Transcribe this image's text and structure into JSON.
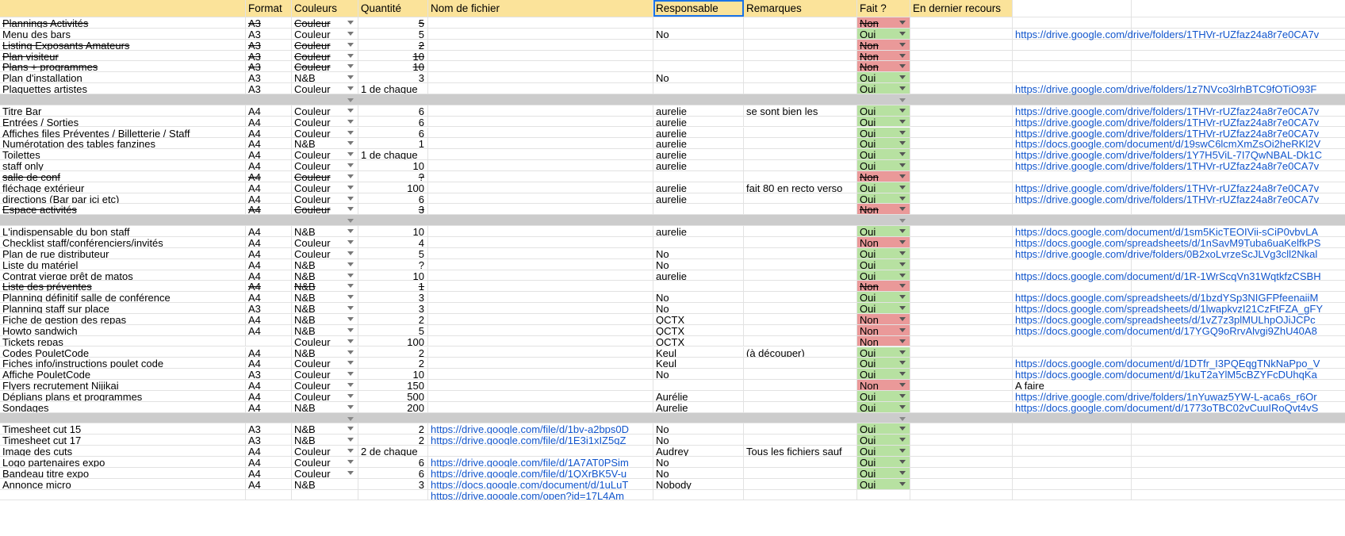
{
  "header": {
    "columns": [
      "",
      "Format",
      "Couleurs",
      "Quantité",
      "Nom de fichier",
      "Responsable",
      "Remarques",
      "Fait ?",
      "En dernier recours",
      "",
      ""
    ]
  },
  "colors": {
    "header_bg": "#fbe39a",
    "oui": "#b7e1a1",
    "non": "#ea9999",
    "separator": "#cccccc",
    "link": "#1155cc",
    "selection": "#1a73e8"
  },
  "rows": [
    {
      "type": "data",
      "name": "Plannings Activités",
      "format": "A3",
      "couleurs": "Couleur",
      "dd": true,
      "quantite": "5",
      "qty_align": "right",
      "fichier": "",
      "responsable": "",
      "remarques": "",
      "fait": "Non",
      "recours": "",
      "extra": "",
      "strike": true
    },
    {
      "type": "data",
      "name": "Menu des bars",
      "format": "A3",
      "couleurs": "Couleur",
      "dd": true,
      "quantite": "5",
      "qty_align": "right",
      "fichier": "",
      "responsable": "No",
      "remarques": "",
      "fait": "Oui",
      "recours": "",
      "extra": "https://drive.google.com/drive/folders/1THVr-rUZfaz24a8r7e0CA7v",
      "strike": false
    },
    {
      "type": "data",
      "name": "Listing Exposants Amateurs",
      "format": "A3",
      "couleurs": "Couleur",
      "dd": true,
      "quantite": "2",
      "qty_align": "right",
      "fichier": "",
      "responsable": "",
      "remarques": "",
      "fait": "Non",
      "recours": "",
      "extra": "",
      "strike": true
    },
    {
      "type": "data",
      "name": "Plan visiteur",
      "format": "A3",
      "couleurs": "Couleur",
      "dd": true,
      "quantite": "10",
      "qty_align": "right",
      "fichier": "",
      "responsable": "",
      "remarques": "",
      "fait": "Non",
      "recours": "",
      "extra": "",
      "strike": true
    },
    {
      "type": "data",
      "name": "Plans + programmes",
      "format": "A3",
      "couleurs": "Couleur",
      "dd": true,
      "quantite": "10",
      "qty_align": "right",
      "fichier": "",
      "responsable": "",
      "remarques": "",
      "fait": "Non",
      "recours": "",
      "extra": "",
      "strike": true
    },
    {
      "type": "data",
      "name": "Plan d'installation",
      "format": "A3",
      "couleurs": "N&B",
      "dd": true,
      "quantite": "3",
      "qty_align": "right",
      "fichier": "",
      "responsable": "No",
      "remarques": "",
      "fait": "Oui",
      "recours": "",
      "extra": "",
      "strike": false
    },
    {
      "type": "data",
      "name": "Plaquettes artistes",
      "format": "A3",
      "couleurs": "Couleur",
      "dd": true,
      "quantite": "1 de chaque",
      "qty_align": "left",
      "fichier": "",
      "responsable": "",
      "remarques": "",
      "fait": "Oui",
      "recours": "",
      "extra": "https://drive.google.com/drive/folders/1z7NVco3lrhBTC9fOTiO93F",
      "strike": false
    },
    {
      "type": "sep"
    },
    {
      "type": "data",
      "name": "Titre Bar",
      "format": "A4",
      "couleurs": "Couleur",
      "dd": true,
      "quantite": "6",
      "qty_align": "right",
      "fichier": "",
      "responsable": "aurelie",
      "remarques": "se sont bien les",
      "fait": "Oui",
      "recours": "",
      "extra": "https://drive.google.com/drive/folders/1THVr-rUZfaz24a8r7e0CA7v",
      "strike": false
    },
    {
      "type": "data",
      "name": "Entrées / Sorties",
      "format": "A4",
      "couleurs": "Couleur",
      "dd": true,
      "quantite": "6",
      "qty_align": "right",
      "fichier": "",
      "responsable": "aurelie",
      "remarques": "",
      "fait": "Oui",
      "recours": "",
      "extra": "https://drive.google.com/drive/folders/1THVr-rUZfaz24a8r7e0CA7v",
      "strike": false
    },
    {
      "type": "data",
      "name": "Affiches files Préventes / Billetterie / Staff",
      "format": "A4",
      "couleurs": "Couleur",
      "dd": true,
      "quantite": "6",
      "qty_align": "right",
      "fichier": "",
      "responsable": "aurelie",
      "remarques": "",
      "fait": "Oui",
      "recours": "",
      "extra": "https://drive.google.com/drive/folders/1THVr-rUZfaz24a8r7e0CA7v",
      "strike": false
    },
    {
      "type": "data",
      "name": "Numérotation des tables fanzines",
      "format": "A4",
      "couleurs": "N&B",
      "dd": true,
      "quantite": "1",
      "qty_align": "right",
      "fichier": "",
      "responsable": "aurelie",
      "remarques": "",
      "fait": "Oui",
      "recours": "",
      "extra": "https://docs.google.com/document/d/19swC6lcmXmZsOi2heRKl2V",
      "strike": false
    },
    {
      "type": "data",
      "name": "Toilettes",
      "format": "A4",
      "couleurs": "Couleur",
      "dd": true,
      "quantite": "1 de chaque",
      "qty_align": "left",
      "fichier": "",
      "responsable": "aurelie",
      "remarques": "",
      "fait": "Oui",
      "recours": "",
      "extra": "https://drive.google.com/drive/folders/1Y7H5ViL-7I7QwNBAL-Dk1C",
      "strike": false
    },
    {
      "type": "data",
      "name": "staff only",
      "format": "A4",
      "couleurs": "Couleur",
      "dd": true,
      "quantite": "10",
      "qty_align": "right",
      "fichier": "",
      "responsable": "aurelie",
      "remarques": "",
      "fait": "Oui",
      "recours": "",
      "extra": "https://drive.google.com/drive/folders/1THVr-rUZfaz24a8r7e0CA7v",
      "strike": false
    },
    {
      "type": "data",
      "name": "salle de conf",
      "format": "A4",
      "couleurs": "Couleur",
      "dd": true,
      "quantite": "?",
      "qty_align": "right",
      "fichier": "",
      "responsable": "",
      "remarques": "",
      "fait": "Non",
      "recours": "",
      "extra": "",
      "strike": true
    },
    {
      "type": "data",
      "name": "fléchage extérieur",
      "format": "A4",
      "couleurs": "Couleur",
      "dd": true,
      "quantite": "100",
      "qty_align": "right",
      "fichier": "",
      "responsable": "aurelie",
      "remarques": "fait 80 en recto verso",
      "fait": "Oui",
      "recours": "",
      "extra": "https://drive.google.com/drive/folders/1THVr-rUZfaz24a8r7e0CA7v",
      "strike": false
    },
    {
      "type": "data",
      "name": "directions (Bar par ici etc)",
      "format": "A4",
      "couleurs": "Couleur",
      "dd": true,
      "quantite": "6",
      "qty_align": "right",
      "fichier": "",
      "responsable": "aurelie",
      "remarques": "",
      "fait": "Oui",
      "recours": "",
      "extra": "https://drive.google.com/drive/folders/1THVr-rUZfaz24a8r7e0CA7v",
      "strike": false
    },
    {
      "type": "data",
      "name": "Espace activités",
      "format": "A4",
      "couleurs": "Couleur",
      "dd": true,
      "quantite": "3",
      "qty_align": "right",
      "fichier": "",
      "responsable": "",
      "remarques": "",
      "fait": "Non",
      "recours": "",
      "extra": "",
      "strike": true
    },
    {
      "type": "sep"
    },
    {
      "type": "data",
      "name": "L'indispensable du bon staff",
      "format": "A4",
      "couleurs": "N&B",
      "dd": true,
      "quantite": "10",
      "qty_align": "right",
      "fichier": "",
      "responsable": "aurelie",
      "remarques": "",
      "fait": "Oui",
      "recours": "",
      "extra": "https://docs.google.com/document/d/1sm5KicTEOIVii-sCiP0vbvLA",
      "strike": false
    },
    {
      "type": "data",
      "name": "Checklist staff/conférenciers/invités",
      "format": "A4",
      "couleurs": "Couleur",
      "dd": true,
      "quantite": "4",
      "qty_align": "right",
      "fichier": "",
      "responsable": "",
      "remarques": "",
      "fait": "Non",
      "recours": "",
      "extra": "https://docs.google.com/spreadsheets/d/1nSavM9Tuba6uaKelfkPS",
      "strike": false
    },
    {
      "type": "data",
      "name": "Plan de rue distributeur",
      "format": "A4",
      "couleurs": "Couleur",
      "dd": true,
      "quantite": "5",
      "qty_align": "right",
      "fichier": "",
      "responsable": "No",
      "remarques": "",
      "fait": "Oui",
      "recours": "",
      "extra": "https://drive.google.com/drive/folders/0B2xoLvrzeScJLVg3cll2Nkal",
      "strike": false
    },
    {
      "type": "data",
      "name": "Liste du matériel",
      "format": "A4",
      "couleurs": "N&B",
      "dd": true,
      "quantite": "?",
      "qty_align": "right",
      "fichier": "",
      "responsable": "No",
      "remarques": "",
      "fait": "Oui",
      "recours": "",
      "extra": "",
      "strike": false
    },
    {
      "type": "data",
      "name": "Contrat vierge prêt de matos",
      "format": "A4",
      "couleurs": "N&B",
      "dd": true,
      "quantite": "10",
      "qty_align": "right",
      "fichier": "",
      "responsable": "aurelie",
      "remarques": "",
      "fait": "Oui",
      "recours": "",
      "extra": "https://docs.google.com/document/d/1R-1WrScqVn31WqtkfzCSBH",
      "strike": false
    },
    {
      "type": "data",
      "name": "Liste des préventes",
      "format": "A4",
      "couleurs": "N&B",
      "dd": true,
      "quantite": "1",
      "qty_align": "right",
      "fichier": "",
      "responsable": "",
      "remarques": "",
      "fait": "Non",
      "recours": "",
      "extra": "",
      "strike": true
    },
    {
      "type": "data",
      "name": "Planning définitif salle de conférence",
      "format": "A4",
      "couleurs": "N&B",
      "dd": true,
      "quantite": "3",
      "qty_align": "right",
      "fichier": "",
      "responsable": "No",
      "remarques": "",
      "fait": "Oui",
      "recours": "",
      "extra": "https://docs.google.com/spreadsheets/d/1bzdYSp3NIGFPfeenaiiM",
      "strike": false
    },
    {
      "type": "data",
      "name": "Planning staff sur place",
      "format": "A3",
      "couleurs": "N&B",
      "dd": true,
      "quantite": "3",
      "qty_align": "right",
      "fichier": "",
      "responsable": "No",
      "remarques": "",
      "fait": "Oui",
      "recours": "",
      "extra": "https://docs.google.com/spreadsheets/d/1lwapkvzI21CzFtFZA_gFY",
      "strike": false
    },
    {
      "type": "data",
      "name": "Fiche de gestion des repas",
      "format": "A4",
      "couleurs": "N&B",
      "dd": true,
      "quantite": "2",
      "qty_align": "right",
      "fichier": "",
      "responsable": "QCTX",
      "remarques": "",
      "fait": "Non",
      "recours": "",
      "extra": "https://docs.google.com/spreadsheets/d/1vZ7z3plMULhpOJiJCPc",
      "strike": false
    },
    {
      "type": "data",
      "name": "Howto sandwich",
      "format": "A4",
      "couleurs": "N&B",
      "dd": true,
      "quantite": "5",
      "qty_align": "right",
      "fichier": "",
      "responsable": "QCTX",
      "remarques": "",
      "fait": "Non",
      "recours": "",
      "extra": "https://docs.google.com/document/d/17YGQ9oRrvAlvgi9ZhU40A8",
      "strike": false
    },
    {
      "type": "data",
      "name": "Tickets repas",
      "format": "",
      "couleurs": "Couleur",
      "dd": true,
      "quantite": "100",
      "qty_align": "right",
      "fichier": "",
      "responsable": "QCTX",
      "remarques": "",
      "fait": "Non",
      "recours": "",
      "extra": "",
      "strike": false
    },
    {
      "type": "data",
      "name": "Codes PouletCode",
      "format": "A4",
      "couleurs": "N&B",
      "dd": true,
      "quantite": "2",
      "qty_align": "right",
      "fichier": "",
      "responsable": "Keul",
      "remarques": "(à découper)",
      "fait": "Oui",
      "recours": "",
      "extra": "",
      "strike": false
    },
    {
      "type": "data",
      "name": "Fiches info/instructions poulet code",
      "format": "A4",
      "couleurs": "Couleur",
      "dd": true,
      "quantite": "2",
      "qty_align": "right",
      "fichier": "",
      "responsable": "Keul",
      "remarques": "",
      "fait": "Oui",
      "recours": "",
      "extra": "https://docs.google.com/document/d/1DTfr_I3PQEqgTNkNaPpo_V",
      "strike": false
    },
    {
      "type": "data",
      "name": "Affiche PouletCode",
      "format": "A3",
      "couleurs": "Couleur",
      "dd": true,
      "quantite": "10",
      "qty_align": "right",
      "fichier": "",
      "responsable": "No",
      "remarques": "",
      "fait": "Oui",
      "recours": "",
      "extra": "https://docs.google.com/document/d/1kuT2aYlM5cBZYFcDUhqKa",
      "strike": false
    },
    {
      "type": "data",
      "name": "Flyers recrutement Nijikai",
      "format": "A4",
      "couleurs": "Couleur",
      "dd": true,
      "quantite": "150",
      "qty_align": "right",
      "fichier": "",
      "responsable": "",
      "remarques": "",
      "fait": "Non",
      "recours": "",
      "extra": "A faire",
      "strike": false
    },
    {
      "type": "data",
      "name": "Déplians plans et programmes",
      "format": "A4",
      "couleurs": "Couleur",
      "dd": true,
      "quantite": "500",
      "qty_align": "right",
      "fichier": "",
      "responsable": "Aurélie",
      "remarques": "",
      "fait": "Oui",
      "recours": "",
      "extra": "https://drive.google.com/drive/folders/1nYuwaz5YW-L-aca6s_r6Or",
      "strike": false
    },
    {
      "type": "data",
      "name": "Sondages",
      "format": "A4",
      "couleurs": "N&B",
      "dd": true,
      "quantite": "200",
      "qty_align": "right",
      "fichier": "",
      "responsable": "Aurelie",
      "remarques": "",
      "fait": "Oui",
      "recours": "",
      "extra": "https://docs.google.com/document/d/1773oTBC02vCuuIRoQvt4vS",
      "strike": false
    },
    {
      "type": "sep"
    },
    {
      "type": "data",
      "name": "Timesheet cut 15",
      "format": "A3",
      "couleurs": "N&B",
      "dd": true,
      "quantite": "2",
      "qty_align": "right",
      "fichier": "https://drive.google.com/file/d/1bv-a2bps0D",
      "responsable": "No",
      "remarques": "",
      "fait": "Oui",
      "recours": "",
      "extra": "",
      "strike": false
    },
    {
      "type": "data",
      "name": "Timesheet cut 17",
      "format": "A3",
      "couleurs": "N&B",
      "dd": true,
      "quantite": "2",
      "qty_align": "right",
      "fichier": "https://drive.google.com/file/d/1E3i1xIZ5qZ",
      "responsable": "No",
      "remarques": "",
      "fait": "Oui",
      "recours": "",
      "extra": "",
      "strike": false
    },
    {
      "type": "data",
      "name": "Image des cuts",
      "format": "A4",
      "couleurs": "Couleur",
      "dd": true,
      "quantite": "2 de chaque",
      "qty_align": "left",
      "fichier": "",
      "responsable": "Audrey",
      "remarques": "Tous les fichiers sauf",
      "fait": "Oui",
      "recours": "",
      "extra": "",
      "strike": false
    },
    {
      "type": "data",
      "name": "Logo partenaires expo",
      "format": "A4",
      "couleurs": "Couleur",
      "dd": true,
      "quantite": "6",
      "qty_align": "right",
      "fichier": "https://drive.google.com/file/d/1A7AT0PSim",
      "responsable": "No",
      "remarques": "",
      "fait": "Oui",
      "recours": "",
      "extra": "",
      "strike": false
    },
    {
      "type": "data",
      "name": "Bandeau titre expo",
      "format": "A4",
      "couleurs": "Couleur",
      "dd": true,
      "quantite": "6",
      "qty_align": "right",
      "fichier": "https://drive.google.com/file/d/1QXrBK5V-u",
      "responsable": "No",
      "remarques": "",
      "fait": "Oui",
      "recours": "",
      "extra": "",
      "strike": false
    },
    {
      "type": "data",
      "name": "Annonce micro",
      "format": "A4",
      "couleurs": "N&B",
      "dd": false,
      "quantite": "3",
      "qty_align": "right",
      "fichier": "https://docs.google.com/document/d/1uLuT",
      "responsable": "Nobody",
      "remarques": "",
      "fait": "Oui",
      "recours": "",
      "extra": "",
      "strike": false
    },
    {
      "type": "data",
      "name": "",
      "format": "",
      "couleurs": "",
      "dd": false,
      "quantite": "",
      "qty_align": "right",
      "fichier": "https://drive.google.com/open?id=17L4Am",
      "responsable": "",
      "remarques": "",
      "fait": "",
      "recours": "",
      "extra": "",
      "strike": false
    }
  ]
}
